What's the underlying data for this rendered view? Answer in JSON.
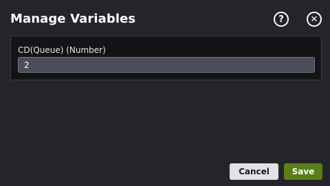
{
  "dialog": {
    "title": "Manage Variables",
    "help_icon": "help-circle-icon",
    "close_icon": "close-circle-icon"
  },
  "field": {
    "label": "CD(Queue) (Number)",
    "value": "2"
  },
  "actions": {
    "cancel_label": "Cancel",
    "save_label": "Save"
  },
  "colors": {
    "background": "#252529",
    "panel": "#141416",
    "input": "#4a4e59",
    "save_accent": "#5a7e19",
    "cancel_bg": "#e2e2e6"
  }
}
